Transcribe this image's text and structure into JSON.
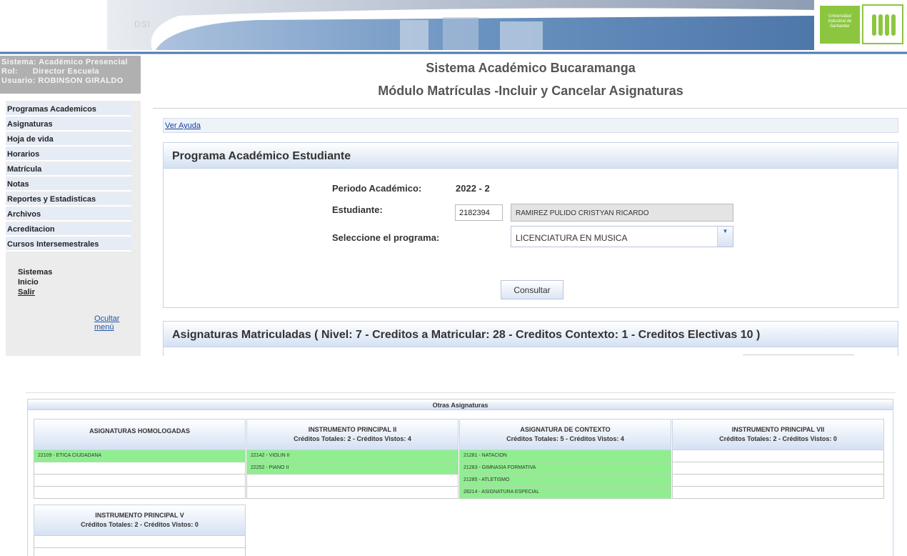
{
  "banner": {
    "dsi": "DSI",
    "uis_text": "Universidad Industrial de Santander"
  },
  "user": {
    "sistema": "Sistema: Académico Presencial",
    "rol": "Rol:      Director Escuela",
    "usuario": "Usuario: ROBINSON GIRALDO"
  },
  "menu": {
    "items": [
      "Programas Academicos",
      "Asignaturas",
      "Hoja de vida",
      "Horarios",
      "Matrícula",
      "Notas",
      "Reportes y Estadisticas",
      "Archivos",
      "Acreditacion",
      "Cursos Intersemestrales"
    ],
    "sistemas": "Sistemas",
    "inicio": "Inicio",
    "salir": "Salir",
    "ocultar": "Ocultar menú"
  },
  "header": {
    "title": "Sistema Académico Bucaramanga",
    "subtitle": "Módulo Matrículas -Incluir y Cancelar Asignaturas"
  },
  "ayuda": "Ver Ayuda",
  "programa_panel": {
    "title": "Programa Académico Estudiante",
    "periodo_label": "Periodo Académico:",
    "periodo_value": "2022 - 2",
    "estudiante_label": "Estudiante:",
    "codigo": "2182394",
    "nombre": "RAMIREZ PULIDO CRISTYAN RICARDO",
    "programa_label": "Seleccione el programa:",
    "programa_selected": "LICENCIATURA EN MUSICA",
    "consultar": "Consultar"
  },
  "matriculadas": {
    "title": "Asignaturas Matriculadas ( Nivel: 7 - Creditos a Matricular: 28 - Creditos Contexto: 1 - Creditos Electivas 10 )"
  },
  "otras": {
    "title": "Otras Asignaturas",
    "groups": [
      {
        "name": "ASIGNATURAS HOMOLOGADAS",
        "credits": "",
        "rows": [
          "22109 - ETICA CIUDADANA",
          "",
          "",
          ""
        ],
        "green": [
          true,
          false,
          false,
          false
        ]
      },
      {
        "name": "INSTRUMENTO PRINCIPAL II",
        "credits": "Créditos Totales: 2 - Créditos Vistos: 4",
        "rows": [
          "22142 - VIOLIN II",
          "22252 - PIANO II",
          "",
          ""
        ],
        "green": [
          true,
          true,
          false,
          false
        ]
      },
      {
        "name": "ASIGNATURA DE CONTEXTO",
        "credits": "Créditos Totales: 5 - Créditos Vistos: 4",
        "rows": [
          "21281 - NATACION",
          "21283 - GIMNASIA FORMATIVA",
          "21285 - ATLETISMO",
          "28214 - ASIGNATURA ESPECIAL"
        ],
        "green": [
          true,
          true,
          true,
          true
        ]
      },
      {
        "name": "INSTRUMENTO PRINCIPAL VII",
        "credits": "Créditos Totales: 2 - Créditos Vistos: 0",
        "rows": [
          "",
          "",
          "",
          ""
        ],
        "green": [
          false,
          false,
          false,
          false
        ]
      },
      {
        "name": "INSTRUMENTO PRINCIPAL V",
        "credits": "Créditos Totales: 2 - Créditos Vistos: 0",
        "rows": [
          "",
          ""
        ],
        "green": [
          false,
          false
        ]
      }
    ]
  }
}
